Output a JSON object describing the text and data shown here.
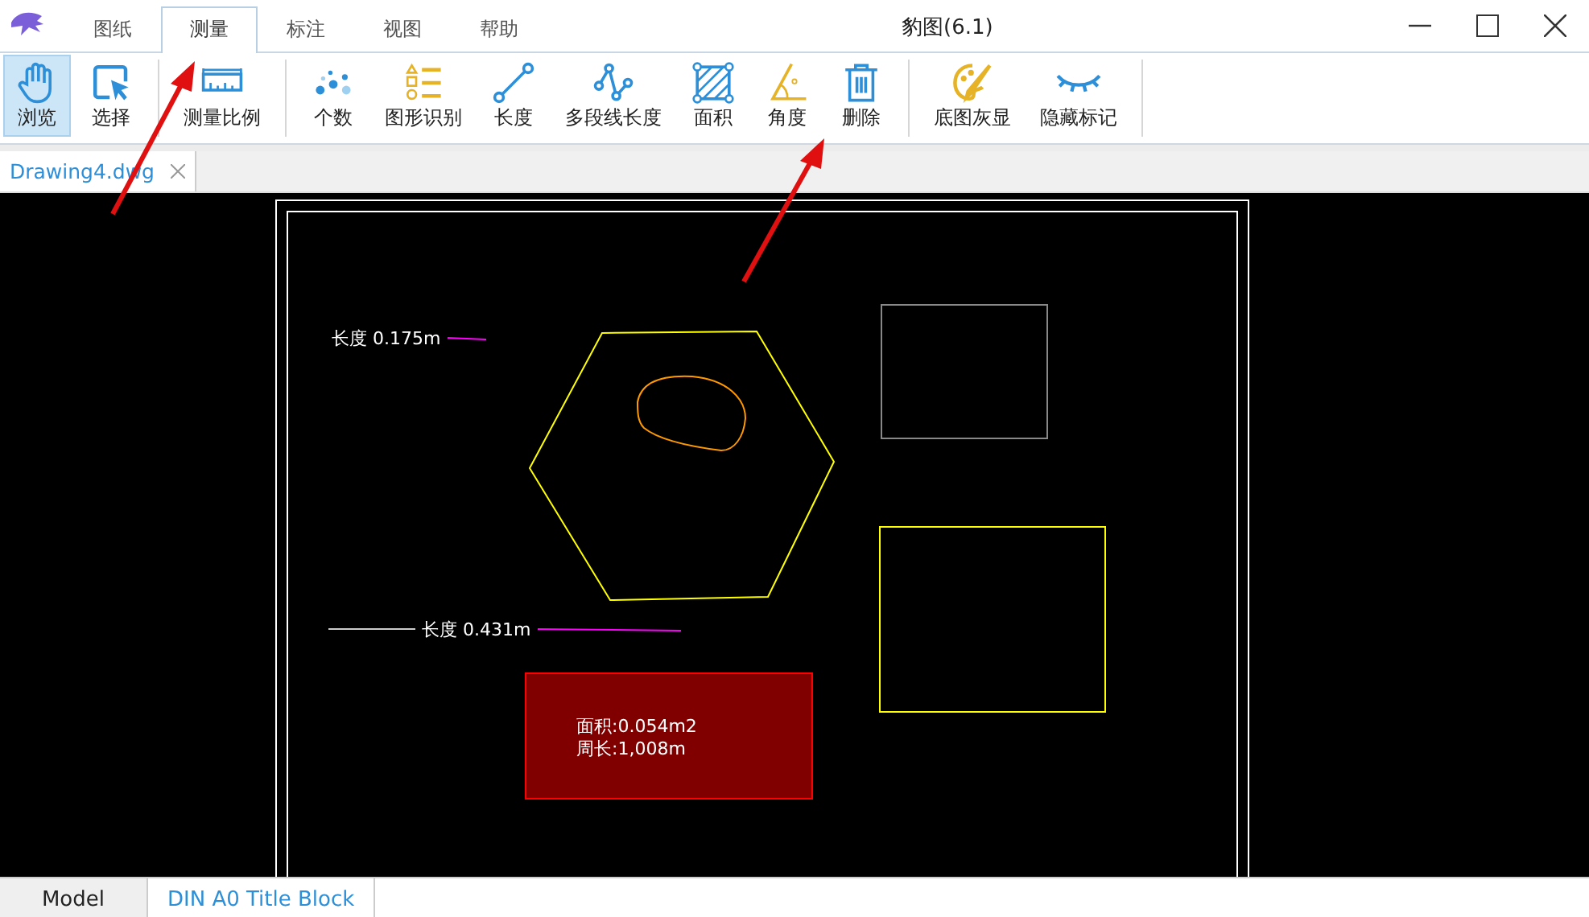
{
  "window": {
    "title": "豹图(6.1)"
  },
  "menu_tabs": [
    {
      "label": "图纸",
      "selected": false
    },
    {
      "label": "测量",
      "selected": true
    },
    {
      "label": "标注",
      "selected": false
    },
    {
      "label": "视图",
      "selected": false
    },
    {
      "label": "帮助",
      "selected": false
    }
  ],
  "ribbon_groups": [
    {
      "buttons": [
        {
          "label": "浏览",
          "selected": true
        },
        {
          "label": "选择",
          "selected": false
        }
      ]
    },
    {
      "buttons": [
        {
          "label": "测量比例",
          "selected": false
        }
      ]
    },
    {
      "buttons": [
        {
          "label": "个数",
          "selected": false
        },
        {
          "label": "图形识别",
          "selected": false
        },
        {
          "label": "长度",
          "selected": false
        },
        {
          "label": "多段线长度",
          "selected": false
        },
        {
          "label": "面积",
          "selected": false
        },
        {
          "label": "角度",
          "selected": false
        },
        {
          "label": "删除",
          "selected": false
        }
      ]
    },
    {
      "buttons": [
        {
          "label": "底图灰显",
          "selected": false
        },
        {
          "label": "隐藏标记",
          "selected": false
        }
      ]
    }
  ],
  "document_tabs": [
    {
      "label": "Drawing4.dwg",
      "selected": true
    }
  ],
  "canvas": {
    "measurements": [
      {
        "kind": "length",
        "label": "长度 0.175m"
      },
      {
        "kind": "length",
        "label": "长度 0.431m"
      },
      {
        "kind": "area",
        "lines": [
          "面积:0.054m2",
          "周长:1,008m"
        ]
      }
    ]
  },
  "layout_tabs": [
    {
      "label": "Model",
      "selected": false
    },
    {
      "label": "DIN A0 Title Block",
      "selected": true
    }
  ]
}
